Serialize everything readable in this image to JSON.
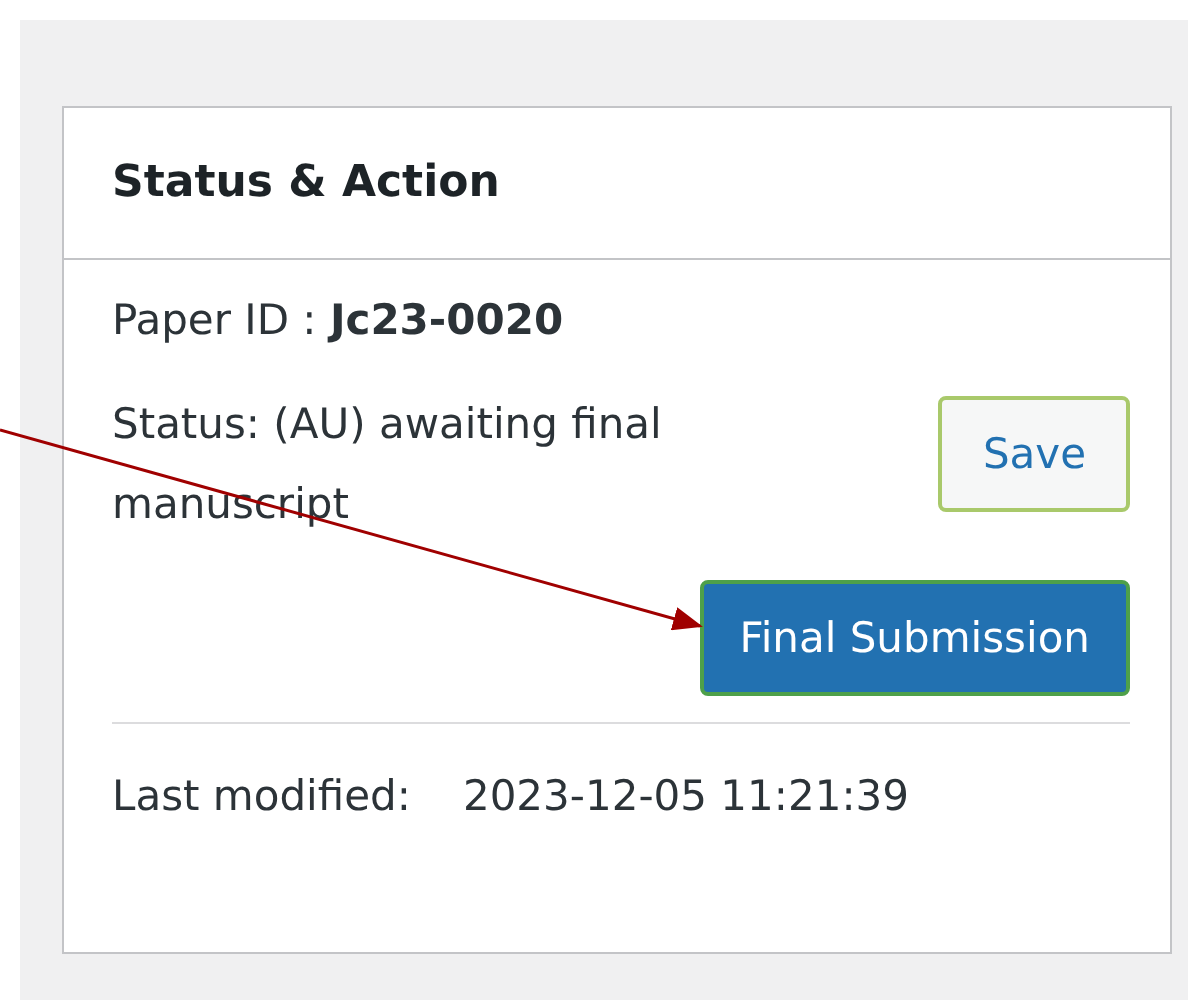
{
  "panel": {
    "title": "Status & Action",
    "paper_id": {
      "label": "Paper ID : ",
      "value": "Jc23-0020"
    },
    "status": "Status: (AU) awaiting final manuscript",
    "buttons": [
      {
        "label": "Save",
        "kind": "secondary"
      },
      {
        "label": "Final Submission",
        "kind": "primary"
      }
    ],
    "last_modified": {
      "label": "Last modified:",
      "value": "2023-12-05 11:21:39"
    }
  }
}
